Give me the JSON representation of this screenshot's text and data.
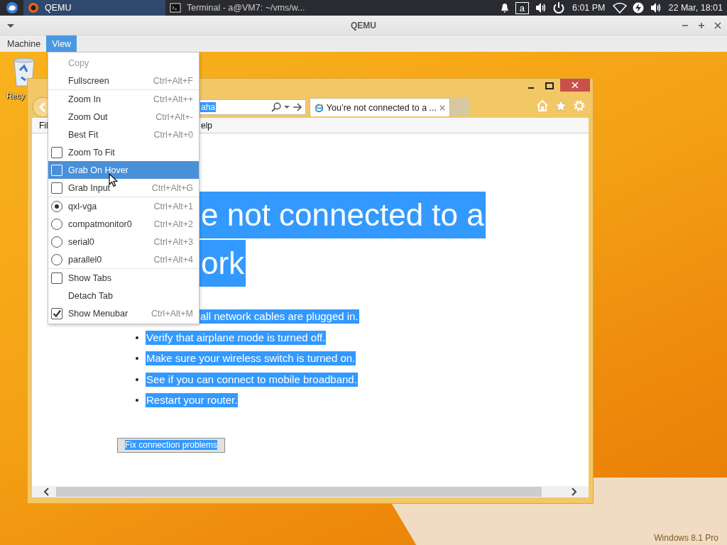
{
  "taskbar": {
    "tasks": [
      {
        "label": "QEMU",
        "selected": true
      },
      {
        "label": "Terminal - a@VM7: ~/vms/w...",
        "selected": false
      }
    ],
    "layout_indicator": "a",
    "clock": "6:01 PM",
    "date": "22 Mar, 18:01"
  },
  "window": {
    "title": "QEMU"
  },
  "menubar": [
    {
      "label": "Machine",
      "selected": false
    },
    {
      "label": "View",
      "selected": true
    }
  ],
  "view_menu": {
    "sections": [
      {
        "items": [
          {
            "kind": "plain",
            "label": "Copy",
            "disabled": true,
            "highlighted": false
          },
          {
            "kind": "plain",
            "label": "Fullscreen",
            "shortcut": "Ctrl+Alt+F",
            "disabled": false,
            "highlighted": false
          }
        ]
      },
      {
        "items": [
          {
            "kind": "plain",
            "label": "Zoom In",
            "shortcut": "Ctrl+Alt++",
            "disabled": false,
            "highlighted": false
          },
          {
            "kind": "plain",
            "label": "Zoom Out",
            "shortcut": "Ctrl+Alt+-",
            "disabled": false,
            "highlighted": false
          },
          {
            "kind": "plain",
            "label": "Best Fit",
            "shortcut": "Ctrl+Alt+0",
            "disabled": false,
            "highlighted": false
          },
          {
            "kind": "check",
            "label": "Zoom To Fit",
            "checked": false,
            "disabled": false,
            "highlighted": false
          },
          {
            "kind": "check",
            "label": "Grab On Hover",
            "checked": false,
            "disabled": false,
            "highlighted": true
          },
          {
            "kind": "check",
            "label": "Grab Input",
            "shortcut": "Ctrl+Alt+G",
            "checked": false,
            "disabled": false,
            "highlighted": false
          }
        ]
      },
      {
        "items": [
          {
            "kind": "radio",
            "label": "qxl-vga",
            "shortcut": "Ctrl+Alt+1",
            "checked": true,
            "disabled": false,
            "highlighted": false
          },
          {
            "kind": "radio",
            "label": "compatmonitor0",
            "shortcut": "Ctrl+Alt+2",
            "checked": false,
            "disabled": false,
            "highlighted": false
          },
          {
            "kind": "radio",
            "label": "serial0",
            "shortcut": "Ctrl+Alt+3",
            "checked": false,
            "disabled": false,
            "highlighted": false
          },
          {
            "kind": "radio",
            "label": "parallel0",
            "shortcut": "Ctrl+Alt+4",
            "checked": false,
            "disabled": false,
            "highlighted": false
          }
        ]
      },
      {
        "items": [
          {
            "kind": "check",
            "label": "Show Tabs",
            "checked": false,
            "disabled": false,
            "highlighted": false
          },
          {
            "kind": "plain",
            "label": "Detach Tab",
            "disabled": false,
            "highlighted": false
          },
          {
            "kind": "check",
            "label": "Show Menubar",
            "shortcut": "Ctrl+Alt+M",
            "checked": true,
            "disabled": false,
            "highlighted": false
          }
        ]
      }
    ]
  },
  "desktop": {
    "icons": [
      {
        "label": "Recy"
      }
    ],
    "edition": "Windows 8.1 Pro"
  },
  "browser": {
    "address": "aha",
    "tab": {
      "title": "You’re not connected to a ...",
      "selected": true
    },
    "menu": [
      "Fil",
      "elp"
    ],
    "heading_lines": [
      "e not connected to a",
      "ork"
    ],
    "bullets": [
      {
        "kind": "partial",
        "text": "all network cables are plugged in."
      },
      {
        "kind": "full",
        "text": "Verify that airplane mode is turned off."
      },
      {
        "kind": "full",
        "text": "Make sure your wireless switch is turned on."
      },
      {
        "kind": "full",
        "text": "See if you can connect to mobile broadband."
      },
      {
        "kind": "full",
        "text": "Restart your router."
      }
    ],
    "button": "Fix connection problems"
  }
}
